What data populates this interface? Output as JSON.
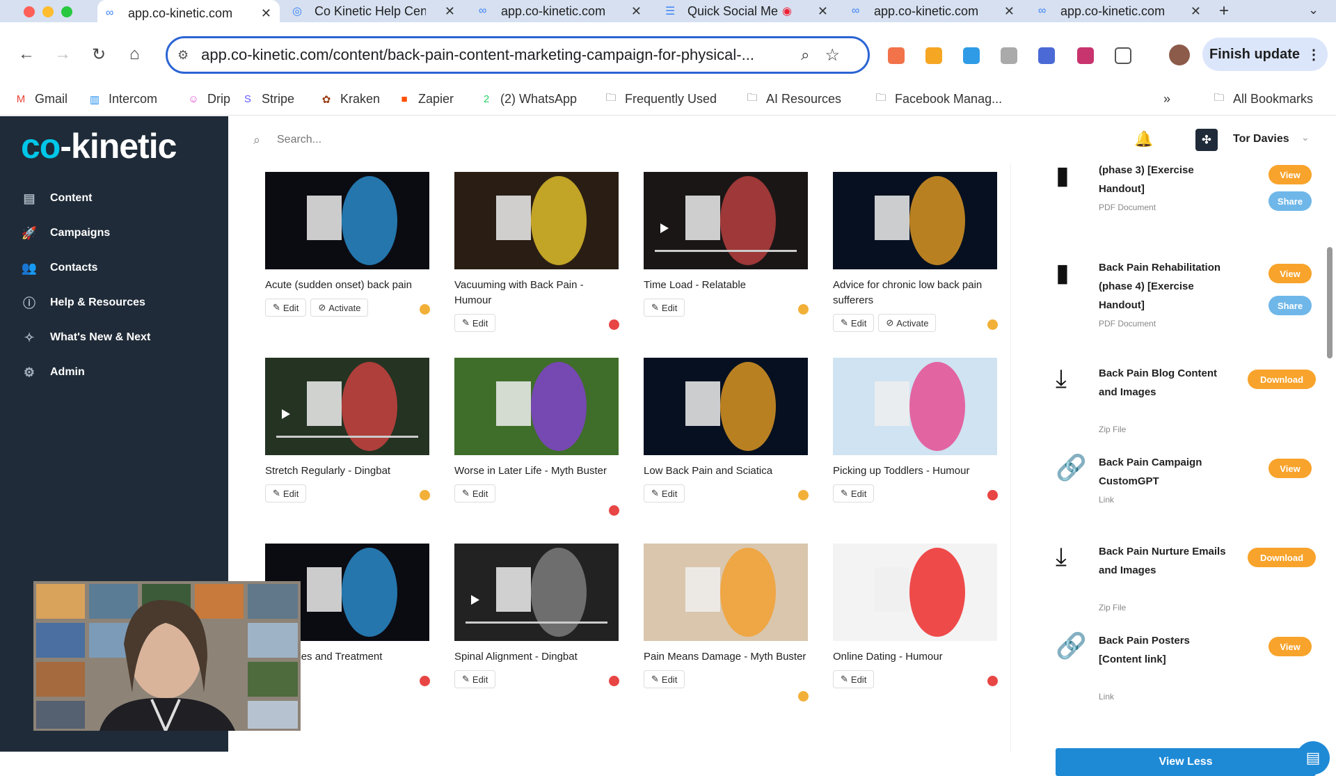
{
  "tabs": [
    {
      "title": "app.co-kinetic.com",
      "active": true
    },
    {
      "title": "Co Kinetic Help Center"
    },
    {
      "title": "app.co-kinetic.com"
    },
    {
      "title": "Quick Social Media"
    },
    {
      "title": "app.co-kinetic.com"
    },
    {
      "title": "app.co-kinetic.com"
    }
  ],
  "toolbar": {
    "url": "app.co-kinetic.com/content/back-pain-content-marketing-campaign-for-physical-...",
    "finish_update": "Finish update"
  },
  "bookmarks": [
    {
      "label": "Gmail",
      "color": "#ea4335",
      "glyph": "M"
    },
    {
      "label": "Intercom",
      "color": "#1f8ded",
      "glyph": "▥"
    },
    {
      "label": "Drip",
      "color": "#e84bd6",
      "glyph": "☺"
    },
    {
      "label": "Stripe",
      "color": "#635bff",
      "glyph": "S"
    },
    {
      "label": "Kraken",
      "color": "#9a3b12",
      "glyph": "✿"
    },
    {
      "label": "Zapier",
      "color": "#ff4f00",
      "glyph": "■"
    },
    {
      "label": "(2) WhatsApp",
      "color": "#25d366",
      "glyph": "2"
    },
    {
      "label": "Frequently Used",
      "color": "#444",
      "glyph": "🗀"
    },
    {
      "label": "AI Resources",
      "color": "#444",
      "glyph": "🗀"
    },
    {
      "label": "Facebook Manag...",
      "color": "#444",
      "glyph": "🗀"
    }
  ],
  "bookmarks_more": "»",
  "bookmarks_all": "All Bookmarks",
  "logo": {
    "co": "co",
    "rest": "-kinetic"
  },
  "nav": [
    {
      "label": "Content",
      "icon": "▤"
    },
    {
      "label": "Campaigns",
      "icon": "🚀"
    },
    {
      "label": "Contacts",
      "icon": "👥"
    },
    {
      "label": "Help & Resources",
      "icon": "ⓘ"
    },
    {
      "label": "What's New & Next",
      "icon": "✧"
    },
    {
      "label": "Admin",
      "icon": "⚙"
    }
  ],
  "search": {
    "placeholder": "Search..."
  },
  "user": {
    "name": "Tor Davies"
  },
  "cards": [
    {
      "title": "Acute (sudden onset) back pain",
      "edit": "Edit",
      "activate": "Activate",
      "status": "#f2b039",
      "thumb": "#0b0b12",
      "accent": "#2e9be0"
    },
    {
      "title": "Vacuuming with Back Pain - Humour",
      "edit": "Edit",
      "status": "#e84545",
      "thumb": "#2a1e14",
      "accent": "#f5d22d"
    },
    {
      "title": "Time Load - Relatable",
      "edit": "Edit",
      "status": "#f2b039",
      "thumb": "#1b1616",
      "accent": "#c44",
      "video": true
    },
    {
      "title": "Advice for chronic low back pain sufferers",
      "edit": "Edit",
      "activate": "Activate",
      "status": "#f2b039",
      "thumb": "#061020",
      "accent": "#f5a623"
    },
    {
      "title": "Stretch Regularly - Dingbat",
      "edit": "Edit",
      "status": "#f2b039",
      "thumb": "#243322",
      "accent": "#d44",
      "video": true
    },
    {
      "title": "Worse in Later Life - Myth Buster",
      "edit": "Edit",
      "status": "#e84545",
      "thumb": "#3f6d2a",
      "accent": "#8a3ce0"
    },
    {
      "title": "Low Back Pain and Sciatica",
      "edit": "Edit",
      "status": "#f2b039",
      "thumb": "#061020",
      "accent": "#f5a623"
    },
    {
      "title": "Picking up Toddlers - Humour",
      "edit": "Edit",
      "status": "#e84545",
      "thumb": "#cfe3f2",
      "accent": "#e83a86"
    },
    {
      "title": "a: Causes and Treatment",
      "edit": "",
      "status": "#e84545",
      "thumb": "#0b0b12",
      "accent": "#2e9be0"
    },
    {
      "title": "Spinal Alignment - Dingbat",
      "edit": "Edit",
      "status": "#e84545",
      "thumb": "#222",
      "accent": "#888",
      "video": true
    },
    {
      "title": "Pain Means Damage - Myth Buster",
      "edit": "Edit",
      "status": "#f2b039",
      "thumb": "#d9c6ad",
      "accent": "#f59b23"
    },
    {
      "title": "Online Dating - Humour",
      "edit": "Edit",
      "status": "#e84545",
      "thumb": "#f3f3f3",
      "accent": "#e11"
    }
  ],
  "resources": [
    {
      "title": "(phase 3) [Exercise Handout]",
      "type": "PDF Document",
      "icon": "▮",
      "btn1": "View",
      "btn2": "Share"
    },
    {
      "title": "Back Pain Rehabilitation (phase 4) [Exercise Handout]",
      "type": "PDF Document",
      "icon": "▮",
      "btn1": "View",
      "btn2": "Share"
    },
    {
      "title": "Back Pain Blog Content and Images",
      "type": "Zip File",
      "icon": "⤓",
      "btn1": "Download"
    },
    {
      "title": "Back Pain Campaign CustomGPT",
      "type": "Link",
      "icon": "🔗",
      "btn1": "View"
    },
    {
      "title": "Back Pain Nurture Emails and Images",
      "type": "Zip File",
      "icon": "⤓",
      "btn1": "Download"
    },
    {
      "title": "Back Pain Posters [Content link]",
      "type": "Link",
      "icon": "🔗",
      "btn1": "View"
    }
  ],
  "view_less": "View Less"
}
